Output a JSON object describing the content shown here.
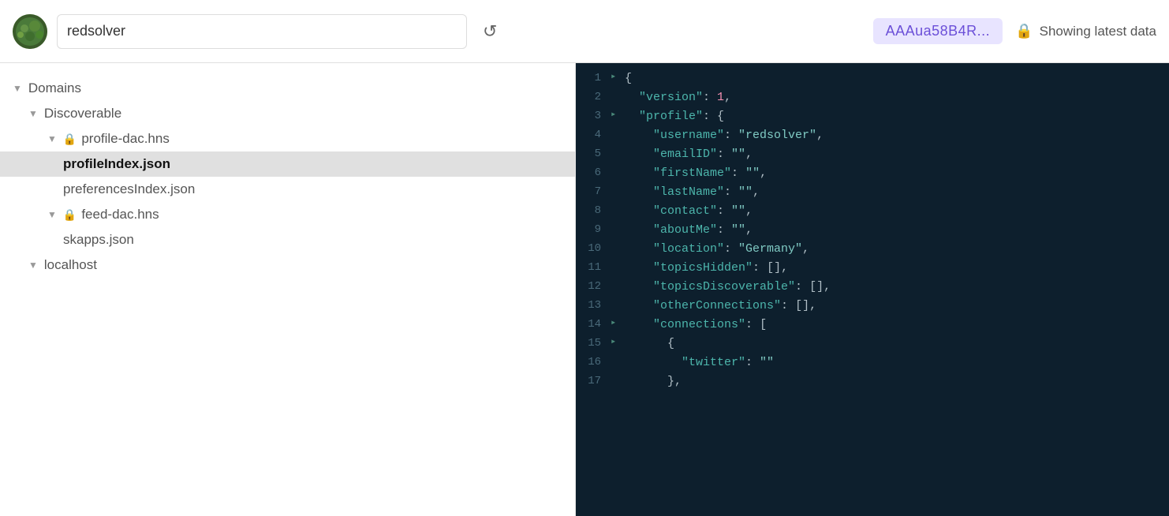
{
  "header": {
    "username": "redsolver",
    "hash_badge": "AAAua58B4R...",
    "showing_latest": "Showing latest data",
    "refresh_icon": "↺",
    "lock_icon": "🔒"
  },
  "sidebar": {
    "items": [
      {
        "id": "domains",
        "label": "Domains",
        "level": 0,
        "type": "chevron-down",
        "selected": false
      },
      {
        "id": "discoverable",
        "label": "Discoverable",
        "level": 1,
        "type": "chevron-down",
        "selected": false
      },
      {
        "id": "profile-dac",
        "label": "profile-dac.hns",
        "level": 2,
        "type": "chevron-down",
        "has_lock": true,
        "selected": false
      },
      {
        "id": "profileIndex",
        "label": "profileIndex.json",
        "level": 3,
        "type": "file",
        "selected": true
      },
      {
        "id": "preferencesIndex",
        "label": "preferencesIndex.json",
        "level": 3,
        "type": "file",
        "selected": false
      },
      {
        "id": "feed-dac",
        "label": "feed-dac.hns",
        "level": 2,
        "type": "chevron-down",
        "has_lock": true,
        "selected": false
      },
      {
        "id": "skapps",
        "label": "skapps.json",
        "level": 3,
        "type": "file",
        "selected": false
      },
      {
        "id": "localhost",
        "label": "localhost",
        "level": 1,
        "type": "chevron-down",
        "selected": false
      }
    ]
  },
  "editor": {
    "lines": [
      {
        "num": 1,
        "arrow": "▸",
        "content": "{"
      },
      {
        "num": 2,
        "arrow": "",
        "content": "  \"version\": 1,"
      },
      {
        "num": 3,
        "arrow": "▸",
        "content": "  \"profile\": {"
      },
      {
        "num": 4,
        "arrow": "",
        "content": "    \"username\": \"redsolver\","
      },
      {
        "num": 5,
        "arrow": "",
        "content": "    \"emailID\": \"\","
      },
      {
        "num": 6,
        "arrow": "",
        "content": "    \"firstName\": \"\","
      },
      {
        "num": 7,
        "arrow": "",
        "content": "    \"lastName\": \"\","
      },
      {
        "num": 8,
        "arrow": "",
        "content": "    \"contact\": \"\","
      },
      {
        "num": 9,
        "arrow": "",
        "content": "    \"aboutMe\": \"\","
      },
      {
        "num": 10,
        "arrow": "",
        "content": "    \"location\": \"Germany\","
      },
      {
        "num": 11,
        "arrow": "",
        "content": "    \"topicsHidden\": [],"
      },
      {
        "num": 12,
        "arrow": "",
        "content": "    \"topicsDiscoverable\": [],"
      },
      {
        "num": 13,
        "arrow": "",
        "content": "    \"otherConnections\": [],"
      },
      {
        "num": 14,
        "arrow": "▸",
        "content": "    \"connections\": ["
      },
      {
        "num": 15,
        "arrow": "▸",
        "content": "      {"
      },
      {
        "num": 16,
        "arrow": "",
        "content": "        \"twitter\": \"\""
      },
      {
        "num": 17,
        "arrow": "",
        "content": "      },"
      }
    ]
  }
}
